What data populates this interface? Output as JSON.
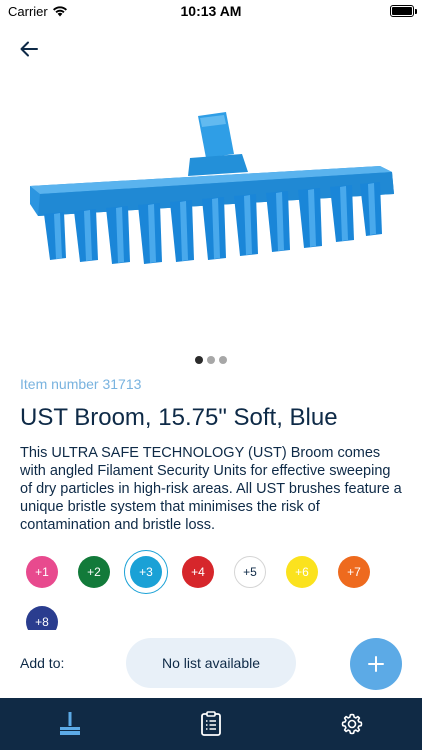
{
  "status_bar": {
    "carrier": "Carrier",
    "time": "10:13 AM",
    "battery_level": 1.0,
    "wifi_icon": "wifi-icon",
    "battery_icon": "battery-icon"
  },
  "nav": {
    "back_icon": "arrow-left-icon"
  },
  "product": {
    "image_icon": "broom-icon",
    "image_color": "#2f9ee6",
    "carousel": {
      "count": 3,
      "active_index": 0
    },
    "item_number": "Item number 31713",
    "title": "UST Broom, 15.75\" Soft, Blue",
    "description": "This ULTRA SAFE TECHNOLOGY (UST) Broom comes with angled Filament Security Units for effective sweeping of dry particles in high-risk areas. All UST brushes feature a unique bristle system that minimises the risk of contamination and bristle loss."
  },
  "variants": [
    {
      "label": "+1",
      "color": "#e84a8e"
    },
    {
      "label": "+2",
      "color": "#127a3a"
    },
    {
      "label": "+3",
      "color": "#1aa1d6",
      "selected": true
    },
    {
      "label": "+4",
      "color": "#d6262b"
    },
    {
      "label": "+5",
      "color": "#ffffff"
    },
    {
      "label": "+6",
      "color": "#fbe21e"
    },
    {
      "label": "+7",
      "color": "#ee6a1e"
    },
    {
      "label": "+8",
      "color": "#2a3d8f"
    }
  ],
  "add_to": {
    "label": "Add to:",
    "list_placeholder": "No list available",
    "add_icon": "plus-icon"
  },
  "tab_bar": {
    "background": "#102a45",
    "tabs": [
      {
        "name": "products",
        "icon": "broom-icon",
        "active": true
      },
      {
        "name": "lists",
        "icon": "clipboard-icon",
        "active": false
      },
      {
        "name": "settings",
        "icon": "gear-icon",
        "active": false
      }
    ]
  },
  "colors": {
    "accent": "#5caae6",
    "item_number": "#79b3df",
    "text": "#0e2a47"
  }
}
